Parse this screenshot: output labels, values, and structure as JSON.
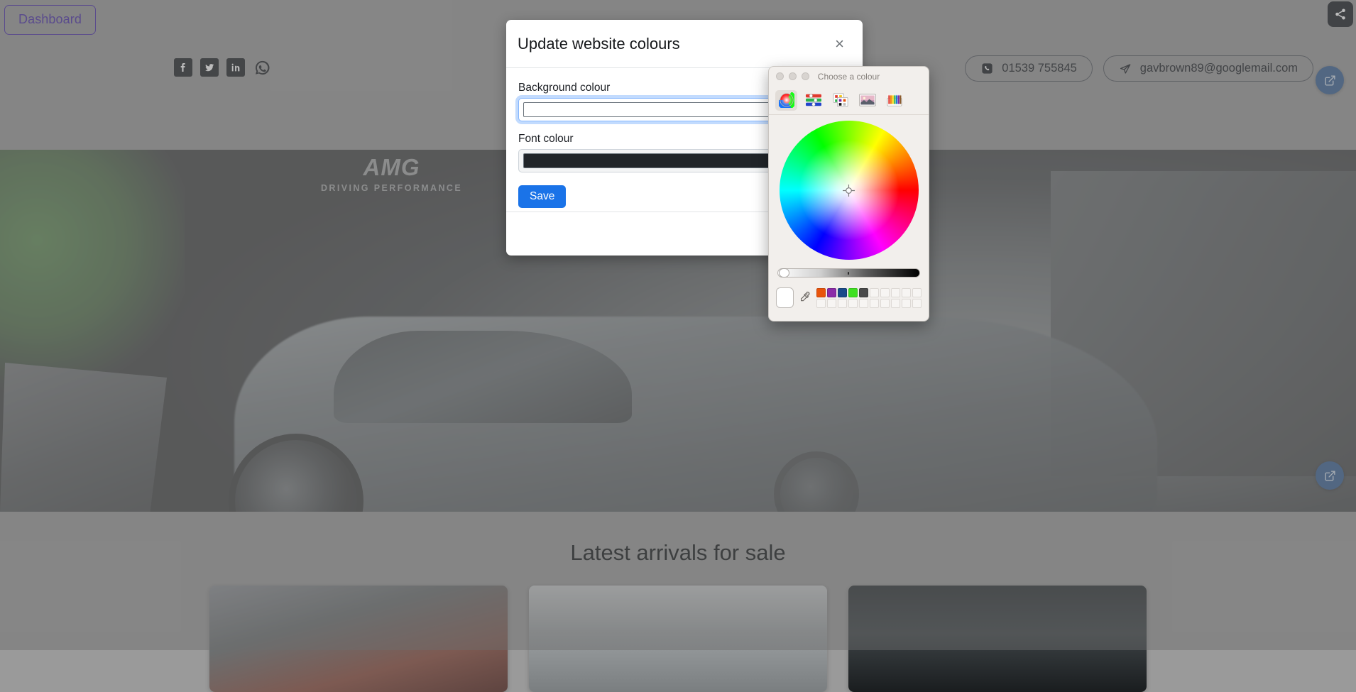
{
  "page": {
    "dashboard_button": "Dashboard",
    "share_icon": "share-icon",
    "socials": [
      {
        "name": "facebook-icon",
        "label": "Facebook"
      },
      {
        "name": "twitter-icon",
        "label": "Twitter"
      },
      {
        "name": "linkedin-icon",
        "label": "LinkedIn"
      },
      {
        "name": "whatsapp-icon",
        "label": "WhatsApp"
      }
    ],
    "contacts": [
      {
        "icon": "phone-icon",
        "text": "01539 755845"
      },
      {
        "icon": "paper-plane-icon",
        "text": "gavbrown89@googlemail.com"
      }
    ],
    "hero": {
      "brand": "AMG",
      "tagline": "DRIVING PERFORMANCE"
    },
    "arrivals": {
      "title": "Latest arrivals for sale",
      "cards": [
        "card-1",
        "card-2",
        "card-3"
      ]
    },
    "edit_buttons": [
      "edit-header-button",
      "edit-arrivals-button"
    ],
    "background_colour": "#9a9a9a"
  },
  "modal": {
    "title": "Update website colours",
    "close_label": "×",
    "fields": [
      {
        "label": "Background colour",
        "value": "",
        "value_hex": "#ffffff",
        "focused": true
      },
      {
        "label": "Font colour",
        "value": "",
        "value_hex": "#212529",
        "focused": false
      }
    ],
    "save_label": "Save"
  },
  "colour_picker": {
    "title": "Choose a colour",
    "window_buttons": [
      "close-button",
      "minimise-button",
      "zoom-button"
    ],
    "tools": [
      {
        "name": "colour-wheel-tool",
        "active": true
      },
      {
        "name": "colour-sliders-tool",
        "active": false
      },
      {
        "name": "colour-palettes-tool",
        "active": false
      },
      {
        "name": "image-palettes-tool",
        "active": false
      },
      {
        "name": "pencils-tool",
        "active": false
      }
    ],
    "selected_colour": "#ffffff",
    "brightness": 100,
    "eyedropper": "eyedropper-icon",
    "swatches": [
      "#e8540b",
      "#8b2ba8",
      "#1a4a8a",
      "#3fe020",
      "#4a4a4a",
      "",
      "",
      "",
      "",
      "",
      "",
      "",
      "",
      "",
      "",
      "",
      "",
      "",
      "",
      ""
    ]
  }
}
